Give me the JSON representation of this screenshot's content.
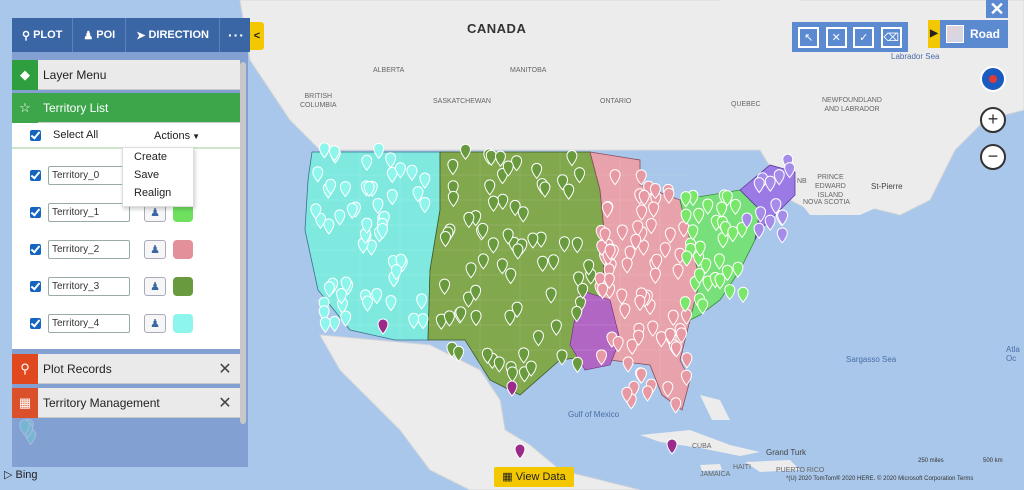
{
  "nav": {
    "plot": "PLOT",
    "poi": "POI",
    "direction": "DIRECTION",
    "more": "···",
    "collapse": "<"
  },
  "panel": {
    "layer_menu": "Layer Menu",
    "territory_list": "Territory List",
    "select_all": "Select All",
    "actions": "Actions",
    "plot_records": "Plot Records",
    "territory_management": "Territory Management",
    "territories": [
      {
        "name": "Territory_0",
        "color": "#e3909a"
      },
      {
        "name": "Territory_1",
        "color": "#6fe05e"
      },
      {
        "name": "Territory_2",
        "color": "#e3909a"
      },
      {
        "name": "Territory_3",
        "color": "#6a9a3e"
      },
      {
        "name": "Territory_4",
        "color": "#8ef5ec"
      }
    ],
    "dropdown": [
      "Create",
      "Save",
      "Realign"
    ]
  },
  "map": {
    "labels": {
      "canada": "CANADA",
      "alberta": "ALBERTA",
      "manitoba": "MANITOBA",
      "bc": "BRITISH\nCOLUMBIA",
      "saskatchewan": "SASKATCHEWAN",
      "ontario": "ONTARIO",
      "quebec": "QUEBEC",
      "newfoundland": "NEWFOUNDLAND\nAND LABRADOR",
      "labrador_sea": "Labrador Sea",
      "nb": "NB",
      "pei": "PRINCE\nEDWARD\nISLAND",
      "nova_scotia": "NOVA SCOTIA",
      "st_pierre": "St-Pierre",
      "sargasso": "Sargasso Sea",
      "atlantic": "Atla\nOc",
      "gulf": "Gulf of Mexico",
      "cuba": "CUBA",
      "grand_turk": "Grand Turk",
      "haiti": "HAITI",
      "jamaica": "JAMAICA",
      "puerto_rico": "PUERTO RICO"
    },
    "view_data": "View Data",
    "bing": "Bing",
    "road": "Road",
    "close": "✕",
    "attribution": "*(U) 2020 TomTom® 2020 HERE. © 2020 Microsoft Corporation  Terms",
    "scale_miles": "250 miles",
    "scale_km": "500 km"
  }
}
